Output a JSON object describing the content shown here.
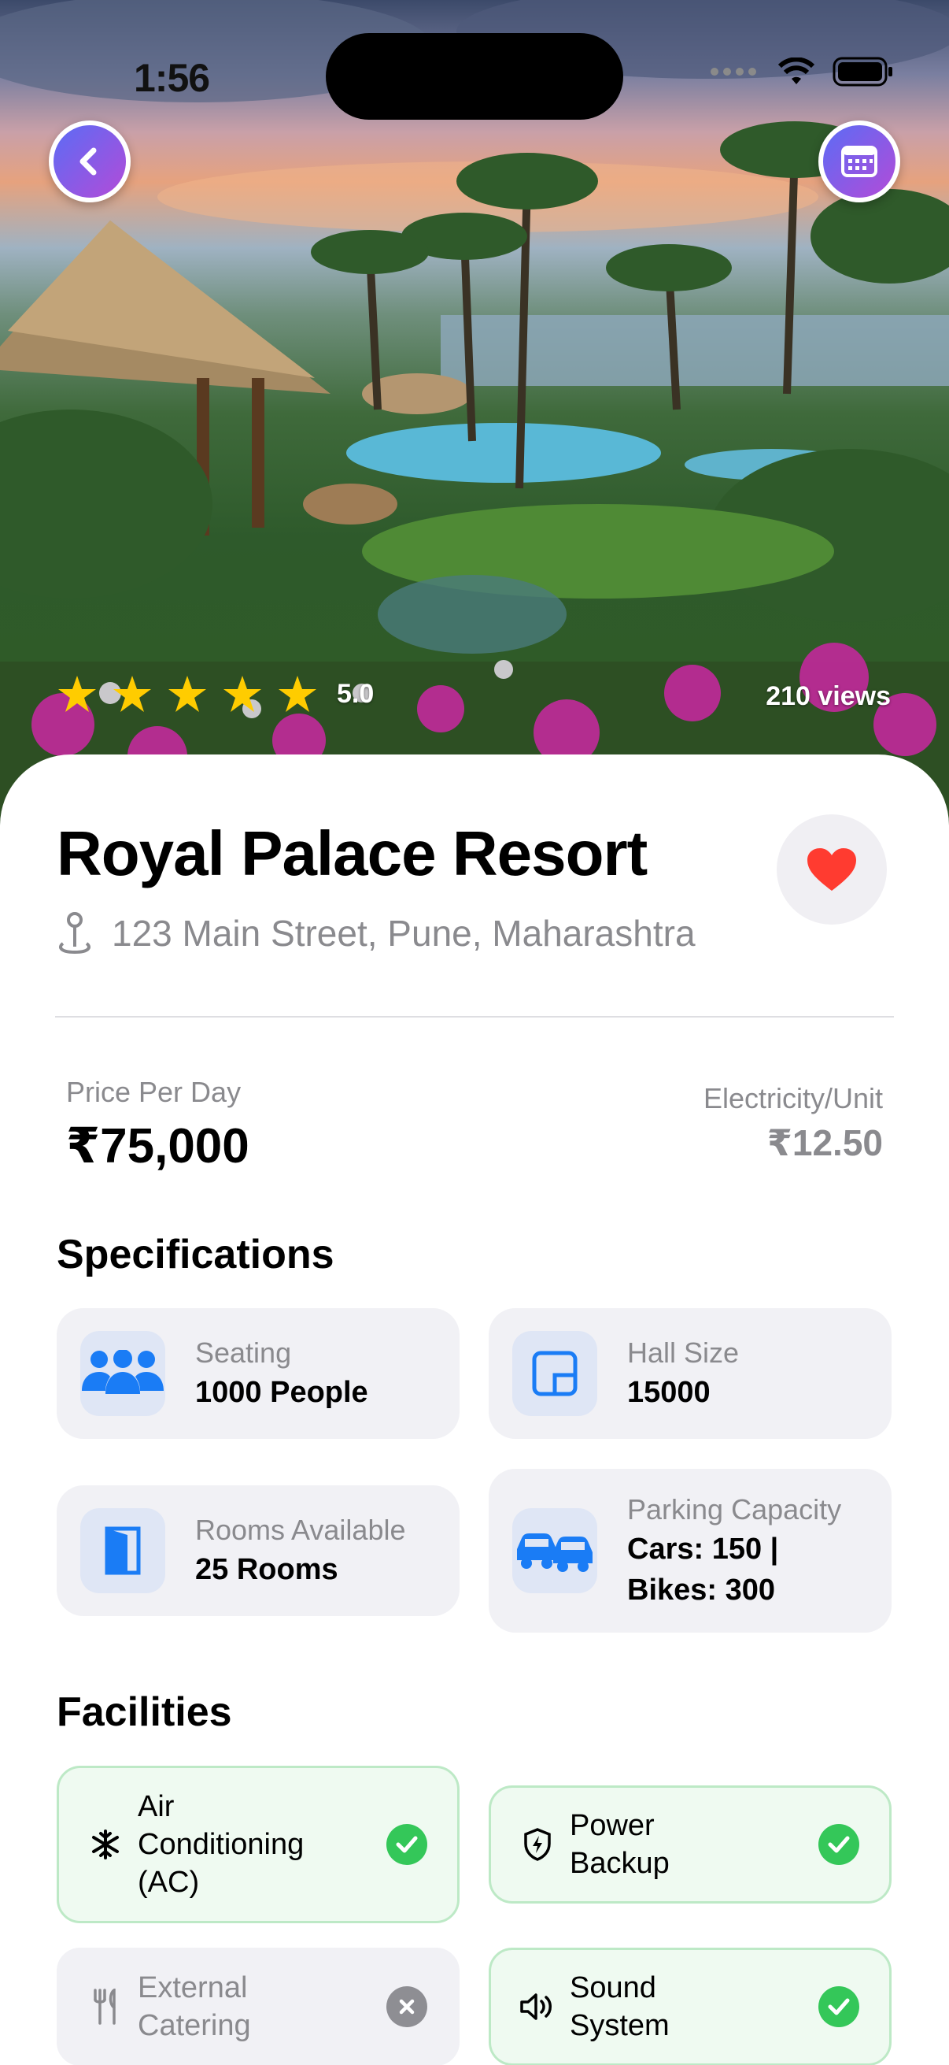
{
  "status_bar": {
    "time": "1:56"
  },
  "hero": {
    "rating": {
      "stars": 5,
      "value": "5.0"
    },
    "views": "210 views"
  },
  "venue": {
    "name": "Royal Palace Resort",
    "address": "123 Main Street, Pune, Maharashtra",
    "favorited": true
  },
  "pricing": {
    "price_label": "Price Per Day",
    "price_value": "₹75,000",
    "electricity_label": "Electricity/Unit",
    "electricity_value": "₹12.50"
  },
  "specifications": {
    "title": "Specifications",
    "items": [
      {
        "label": "Seating",
        "value": "1000 People",
        "icon": "people-icon"
      },
      {
        "label": "Hall Size",
        "value": "15000",
        "icon": "square-icon"
      },
      {
        "label": "Rooms Available",
        "value": "25 Rooms",
        "icon": "door-icon"
      },
      {
        "label": "Parking Capacity",
        "value": "Cars: 150 |",
        "value2": "Bikes: 300",
        "icon": "cars-icon"
      }
    ]
  },
  "facilities": {
    "title": "Facilities",
    "items": [
      {
        "line1": "Air",
        "line2": "Conditioning",
        "line3": "(AC)",
        "available": true,
        "icon": "snowflake-icon"
      },
      {
        "line1": "Power",
        "line2": "Backup",
        "available": true,
        "icon": "shield-bolt-icon"
      },
      {
        "line1": "External",
        "line2": "Catering",
        "available": false,
        "icon": "fork-knife-icon"
      },
      {
        "line1": "Sound",
        "line2": "System",
        "available": true,
        "icon": "speaker-icon"
      }
    ]
  },
  "colors": {
    "accent_gradient_start": "#5b6cf5",
    "accent_gradient_end": "#b34bd8",
    "icon_blue": "#1a7cf5",
    "favorite_red": "#ff3b30",
    "star_yellow": "#ffcc00",
    "check_green": "#34c759",
    "unavailable_gray": "#8e8e93"
  }
}
